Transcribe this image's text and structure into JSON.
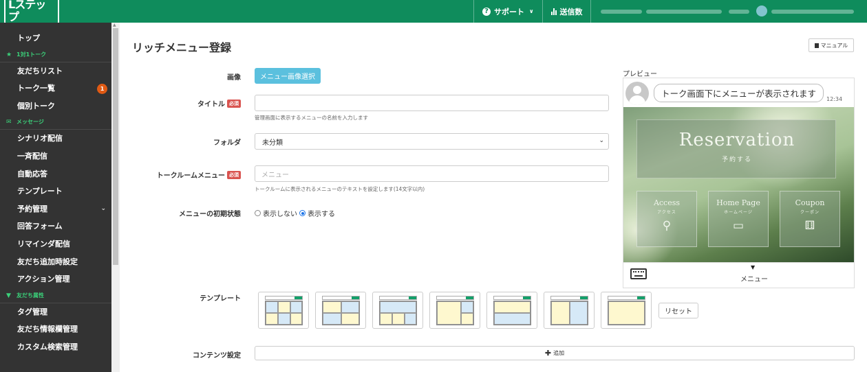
{
  "brand": {
    "logo_text": "Lステップ",
    "accent": "#0f8c5c"
  },
  "topnav": {
    "support_label": "サポート",
    "sendcount_label": "送信数"
  },
  "sidebar": {
    "items": [
      {
        "label": "トップ",
        "type": "item"
      },
      {
        "label": "1対1トーク",
        "type": "header",
        "icon": "star-icon"
      },
      {
        "label": "友だちリスト",
        "type": "item"
      },
      {
        "label": "トーク一覧",
        "type": "item",
        "badge": "1"
      },
      {
        "label": "個別トーク",
        "type": "item"
      },
      {
        "label": "メッセージ",
        "type": "header",
        "icon": "megaphone-icon"
      },
      {
        "label": "シナリオ配信",
        "type": "item"
      },
      {
        "label": "一斉配信",
        "type": "item"
      },
      {
        "label": "自動応答",
        "type": "item"
      },
      {
        "label": "テンプレート",
        "type": "item"
      },
      {
        "label": "予約管理",
        "type": "item",
        "chevron": true
      },
      {
        "label": "回答フォーム",
        "type": "item"
      },
      {
        "label": "リマインダ配信",
        "type": "item"
      },
      {
        "label": "友だち追加時設定",
        "type": "item"
      },
      {
        "label": "アクション管理",
        "type": "item"
      },
      {
        "label": "友だち属性",
        "type": "header",
        "icon": "filter-icon"
      },
      {
        "label": "タグ管理",
        "type": "item"
      },
      {
        "label": "友だち情報欄管理",
        "type": "item"
      },
      {
        "label": "カスタム検索管理",
        "type": "item"
      }
    ]
  },
  "page": {
    "title": "リッチメニュー登録",
    "manual_label": "マニュアル"
  },
  "form": {
    "image": {
      "label": "画像",
      "button": "メニュー画像選択"
    },
    "title": {
      "label": "タイトル",
      "required": "必須",
      "placeholder": "",
      "help": "管理画面に表示するメニューの名前を入力します"
    },
    "folder": {
      "label": "フォルダ",
      "value": "未分類"
    },
    "talkroom": {
      "label": "トークルームメニュー",
      "required": "必須",
      "placeholder": "メニュー",
      "help": "トークルームに表示されるメニューのテキストを設定します(14文字以内)"
    },
    "initial": {
      "label": "メニューの初期状態",
      "option_hide": "表示しない",
      "option_show": "表示する",
      "selected": "表示する"
    },
    "template": {
      "label": "テンプレート",
      "reset": "リセット"
    },
    "contents": {
      "label": "コンテンツ設定",
      "add": "追加"
    }
  },
  "preview": {
    "label": "プレビュー",
    "bubble": "トーク画面下にメニューが表示されます",
    "time": "12:34",
    "banner_title": "Reservation",
    "banner_sub": "予約する",
    "tiles": [
      {
        "title": "Access",
        "sub": "アクセス",
        "icon": "pin-icon"
      },
      {
        "title": "Home Page",
        "sub": "ホームページ",
        "icon": "laptop-icon"
      },
      {
        "title": "Coupon",
        "sub": "クーポン",
        "icon": "gift-icon"
      }
    ],
    "menu_label": "メニュー"
  }
}
